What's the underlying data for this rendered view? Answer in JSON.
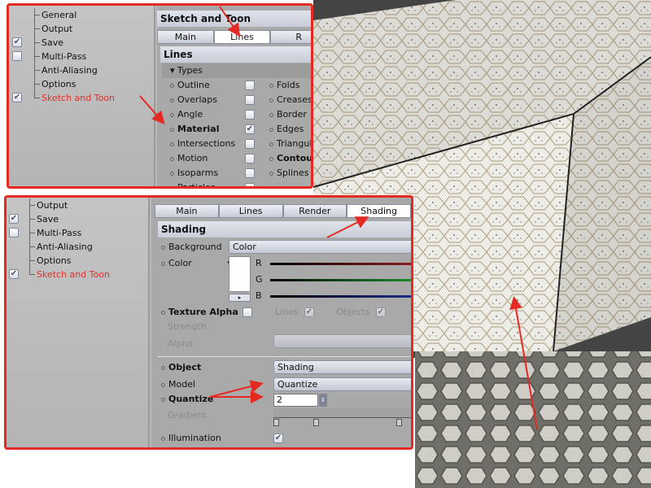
{
  "panel_top": {
    "tree": [
      {
        "label": "General"
      },
      {
        "label": "Output"
      },
      {
        "label": "Save",
        "checked": true
      },
      {
        "label": "Multi-Pass",
        "checked": false
      },
      {
        "label": "Anti-Aliasing"
      },
      {
        "label": "Options"
      },
      {
        "label": "Sketch and Toon",
        "checked": true,
        "active": true
      }
    ],
    "header": "Sketch and Toon",
    "tabs": [
      "Main",
      "Lines",
      "R"
    ],
    "active_tab": "Lines",
    "section": "Lines",
    "group": "Types",
    "left_items": [
      {
        "label": "Outline",
        "checked": false
      },
      {
        "label": "Overlaps",
        "checked": false
      },
      {
        "label": "Angle",
        "checked": false
      },
      {
        "label": "Material",
        "checked": true,
        "bold": true
      },
      {
        "label": "Intersections",
        "checked": false
      },
      {
        "label": "Motion",
        "checked": false
      },
      {
        "label": "Isoparms",
        "checked": false
      },
      {
        "label": "Particles",
        "checked": false
      }
    ],
    "right_items": [
      {
        "label": "Folds"
      },
      {
        "label": "Creases"
      },
      {
        "label": "Border"
      },
      {
        "label": "Edges"
      },
      {
        "label": "Triangul"
      },
      {
        "label": "Contour",
        "bold": true
      },
      {
        "label": "Splines"
      }
    ]
  },
  "panel_bottom": {
    "tree": [
      {
        "label": "Output"
      },
      {
        "label": "Save",
        "checked": true
      },
      {
        "label": "Multi-Pass",
        "checked": false
      },
      {
        "label": "Anti-Aliasing"
      },
      {
        "label": "Options"
      },
      {
        "label": "Sketch and Toon",
        "checked": true,
        "active": true
      }
    ],
    "tabs": [
      "Main",
      "Lines",
      "Render",
      "Shading"
    ],
    "active_tab": "Shading",
    "section": "Shading",
    "background_label": "Background",
    "background_value": "Color",
    "color_label": "Color",
    "channels": [
      "R",
      "G",
      "B"
    ],
    "texture_alpha_label": "Texture Alpha",
    "lines_label": "Lines",
    "objects_label": "Objects",
    "strength_label": "Strength",
    "alpha_label": "Alpha",
    "object_label": "Object",
    "object_value": "Shading",
    "model_label": "Model",
    "model_value": "Quantize",
    "quantize_label": "Quantize",
    "quantize_value": "2",
    "gradient_label": "Gradient",
    "illumination_label": "Illumination",
    "illumination_checked": true
  },
  "colors": {
    "highlight": "#e0302a",
    "border": "#e42a23"
  }
}
